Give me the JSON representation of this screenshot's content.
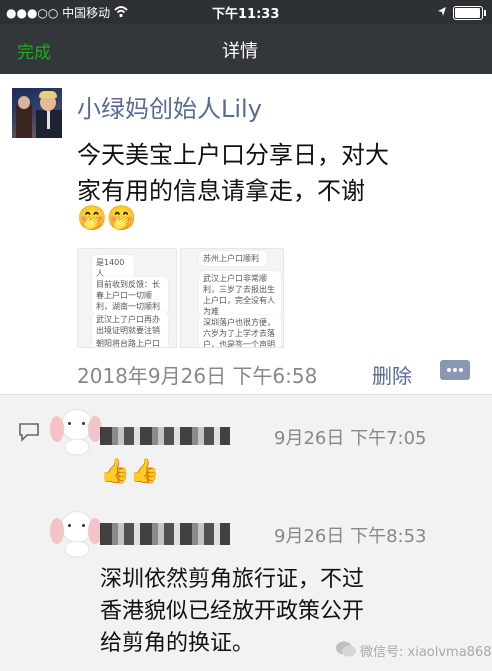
{
  "status_bar": {
    "carrier": "●●●○○ 中国移动",
    "time": "下午11:33"
  },
  "nav": {
    "done": "完成",
    "title": "详情"
  },
  "post": {
    "author": "小绿妈创始人Lily",
    "text_line1": "今天美宝上户口分享日，对大",
    "text_line2": "家有用的信息请拿走，不谢",
    "emoji": "🤭🤭",
    "timestamp": "2018年9月26日 下午6:58",
    "delete": "删除",
    "thumbnails": [
      {
        "messages": [
          "是1400人",
          "目前收到反馈：长春上户口一切顺利，湖南一切顺利",
          "武汉上了户口再办出境证明就要注销户口",
          "朝阳将台路上户口拿了护照，要求说明"
        ]
      },
      {
        "messages": [
          "苏州上户口顺利",
          "武汉上户口非常顺利，三岁了去报出生上户口，完全没有人为难",
          "深圳落户也很方便，六岁为了上学才去落户，也是签一个声明"
        ]
      }
    ]
  },
  "comments": [
    {
      "time": "9月26日 下午7:05",
      "content": "👍👍"
    },
    {
      "time": "9月26日 下午8:53",
      "line1": "深圳依然剪角旅行证，不过",
      "line2": "香港貌似已经放开政策公开",
      "line3": "给剪角的换证。"
    }
  ],
  "watermark": "微信号: xiaolvma868",
  "colors": {
    "status_bg": "#2e3133",
    "nav_bg": "#34373a",
    "done_green": "#1aad19",
    "author_blue": "#576b95",
    "comment_bg": "#f2f2f2"
  }
}
